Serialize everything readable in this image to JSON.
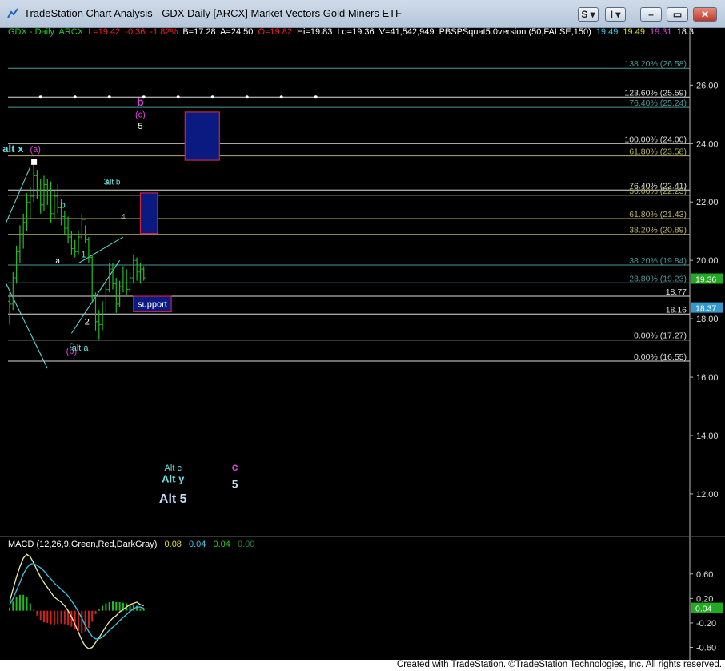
{
  "window": {
    "title": "TradeStation Chart Analysis - GDX Daily [ARCX] Market Vectors Gold Miners ETF",
    "buttons": [
      "S",
      "I"
    ]
  },
  "legend": {
    "symbol": "GDX - Daily",
    "exchange": "ARCX",
    "last": "L=19.42",
    "change": "-0.36",
    "change_pct": "-1.82%",
    "bid": "B=17.28",
    "ask": "A=24.50",
    "open": "O=19.82",
    "high": "Hi=19.83",
    "low": "Lo=19.36",
    "volume": "V=41,542,949",
    "study": "PBSPSquat5.0version (50,FALSE,150)",
    "study_v1": "19.49",
    "study_v2": "19.49",
    "study_v3": "19.31",
    "study_v4": "18.3"
  },
  "macd_legend": {
    "name": "MACD (12,26,9,Green,Red,DarkGray)",
    "v1": "0.08",
    "v2": "0.04",
    "v3": "0.04",
    "v4": "0.00"
  },
  "footer": "Created with TradeStation. ©TradeStation Technologies, Inc. All rights reserved.",
  "colors": {
    "background": "#000000",
    "grid_line": "#ffffff",
    "fib_line": "#b5b26a",
    "label_cyan": "#66e0e0",
    "label_magenta": "#dd44dd",
    "price_bar": "#22bb22",
    "box_fill": "#0a1a80",
    "box_border": "#cc2244",
    "macd_line": "#f0f0a0",
    "signal_line": "#3cc8e8"
  },
  "chart_data": [
    {
      "type": "bar",
      "title": "",
      "ylim": [
        10.6,
        27.6
      ],
      "y_ticks": [
        "26.00",
        "24.00",
        "22.00",
        "20.00",
        "18.00",
        "16.00",
        "14.00",
        "12.00"
      ],
      "price_markers": [
        {
          "label": "19.36",
          "value": 19.36
        },
        {
          "label": "18.37",
          "value": 18.37
        }
      ],
      "fib_levels": [
        {
          "label": "138.20% (26.58)",
          "value": 26.58,
          "color": "#4a9a9a"
        },
        {
          "label": "123.60% (25.59)",
          "value": 25.59,
          "color": "#dddddd"
        },
        {
          "label": "76.40% (25.24)",
          "value": 25.24,
          "color": "#4a9a9a"
        },
        {
          "label": "100.00% (24.00)",
          "value": 24.0,
          "color": "#dddddd"
        },
        {
          "label": "61.80% (23.58)",
          "value": 23.58,
          "color": "#b5b26a"
        },
        {
          "label": "76.40% (22.41)",
          "value": 22.41,
          "color": "#dddddd"
        },
        {
          "label": "50.00% (22.23)",
          "value": 22.23,
          "color": "#b5b26a"
        },
        {
          "label": "61.80% (21.43)",
          "value": 21.43,
          "color": "#b5b26a"
        },
        {
          "label": "38.20% (20.89)",
          "value": 20.89,
          "color": "#b5b26a"
        },
        {
          "label": "38.20% (19.84)",
          "value": 19.84,
          "color": "#4a9a9a"
        },
        {
          "label": "23.80% (19.23)",
          "value": 19.23,
          "color": "#4a9a9a"
        },
        {
          "label": "18.77",
          "value": 18.77,
          "color": "#dddddd"
        },
        {
          "label": "18.16",
          "value": 18.16,
          "color": "#dddddd"
        },
        {
          "label": "0.00% (17.27)",
          "value": 17.27,
          "color": "#dddddd"
        },
        {
          "label": "0.00% (16.55)",
          "value": 16.55,
          "color": "#dddddd"
        }
      ],
      "boxes": [
        {
          "name": "target-c-box",
          "top": 25.08,
          "bottom": 23.43,
          "x0": 51,
          "x1": 61
        },
        {
          "name": "alt-b-box",
          "top": 22.31,
          "bottom": 20.92,
          "x0": 38,
          "x1": 43
        },
        {
          "name": "support-box",
          "top": 18.77,
          "bottom": 18.24,
          "x0": 36,
          "x1": 47,
          "label": "support"
        }
      ],
      "bars": [
        {
          "o": 18.6,
          "h": 18.9,
          "l": 17.8,
          "c": 18.5
        },
        {
          "o": 18.5,
          "h": 19.6,
          "l": 18.3,
          "c": 19.4
        },
        {
          "o": 19.4,
          "h": 20.5,
          "l": 19.2,
          "c": 20.3
        },
        {
          "o": 20.3,
          "h": 21.2,
          "l": 19.9,
          "c": 20.9
        },
        {
          "o": 20.9,
          "h": 21.6,
          "l": 20.4,
          "c": 21.3
        },
        {
          "o": 21.3,
          "h": 22.3,
          "l": 21.0,
          "c": 22.0
        },
        {
          "o": 22.0,
          "h": 22.5,
          "l": 21.4,
          "c": 22.2
        },
        {
          "o": 22.2,
          "h": 23.3,
          "l": 22.0,
          "c": 22.9
        },
        {
          "o": 22.9,
          "h": 23.1,
          "l": 22.1,
          "c": 22.4
        },
        {
          "o": 22.4,
          "h": 22.8,
          "l": 21.6,
          "c": 21.9
        },
        {
          "o": 21.9,
          "h": 22.9,
          "l": 21.7,
          "c": 22.6
        },
        {
          "o": 22.6,
          "h": 22.8,
          "l": 21.9,
          "c": 22.1
        },
        {
          "o": 22.1,
          "h": 22.7,
          "l": 21.3,
          "c": 21.6
        },
        {
          "o": 21.6,
          "h": 22.4,
          "l": 21.4,
          "c": 22.2
        },
        {
          "o": 22.2,
          "h": 22.6,
          "l": 21.6,
          "c": 21.8
        },
        {
          "o": 21.8,
          "h": 22.1,
          "l": 21.2,
          "c": 21.5
        },
        {
          "o": 21.5,
          "h": 21.7,
          "l": 20.9,
          "c": 21.1
        },
        {
          "o": 21.1,
          "h": 21.5,
          "l": 20.6,
          "c": 20.8
        },
        {
          "o": 20.8,
          "h": 21.0,
          "l": 20.2,
          "c": 20.4
        },
        {
          "o": 20.4,
          "h": 20.7,
          "l": 20.1,
          "c": 20.3
        },
        {
          "o": 20.3,
          "h": 21.0,
          "l": 20.2,
          "c": 20.8
        },
        {
          "o": 20.8,
          "h": 21.6,
          "l": 20.7,
          "c": 21.4
        },
        {
          "o": 21.4,
          "h": 21.2,
          "l": 20.6,
          "c": 20.7
        },
        {
          "o": 20.7,
          "h": 20.8,
          "l": 19.9,
          "c": 20.1
        },
        {
          "o": 20.1,
          "h": 20.2,
          "l": 18.6,
          "c": 18.8
        },
        {
          "o": 18.8,
          "h": 18.9,
          "l": 17.6,
          "c": 17.9
        },
        {
          "o": 17.9,
          "h": 18.3,
          "l": 17.3,
          "c": 17.8
        },
        {
          "o": 17.8,
          "h": 18.6,
          "l": 17.6,
          "c": 18.4
        },
        {
          "o": 18.4,
          "h": 19.2,
          "l": 18.2,
          "c": 19.0
        },
        {
          "o": 19.0,
          "h": 19.9,
          "l": 18.9,
          "c": 19.7
        },
        {
          "o": 19.7,
          "h": 19.9,
          "l": 19.0,
          "c": 19.2
        },
        {
          "o": 19.2,
          "h": 19.4,
          "l": 18.2,
          "c": 18.5
        },
        {
          "o": 18.5,
          "h": 19.3,
          "l": 18.4,
          "c": 19.1
        },
        {
          "o": 19.1,
          "h": 19.8,
          "l": 18.9,
          "c": 19.5
        },
        {
          "o": 19.5,
          "h": 19.7,
          "l": 18.8,
          "c": 19.0
        },
        {
          "o": 19.0,
          "h": 19.6,
          "l": 18.9,
          "c": 19.4
        },
        {
          "o": 19.4,
          "h": 20.2,
          "l": 19.2,
          "c": 20.0
        },
        {
          "o": 20.0,
          "h": 20.1,
          "l": 19.3,
          "c": 19.6
        },
        {
          "o": 19.6,
          "h": 19.9,
          "l": 19.2,
          "c": 19.7
        },
        {
          "o": 19.7,
          "h": 19.8,
          "l": 19.3,
          "c": 19.4
        }
      ],
      "trendlines": [
        {
          "x0": 20,
          "y0": 19.9,
          "x1": 33,
          "y1": 20.8,
          "color": "#66e0e0"
        },
        {
          "x0": 18,
          "y0": 17.5,
          "x1": 32,
          "y1": 20.0,
          "color": "#66e0e0"
        },
        {
          "x0": -1,
          "y0": 19.2,
          "x1": 11,
          "y1": 16.3,
          "color": "#66e0e0"
        },
        {
          "x0": -1,
          "y0": 21.3,
          "x1": 6,
          "y1": 23.2,
          "color": "#66e0e0"
        }
      ],
      "annotations": [
        {
          "text": "alt x",
          "x": 1,
          "y": 23.7,
          "color": "#66e0e0",
          "size": 13,
          "bold": true
        },
        {
          "text": "(a)",
          "x": 7.5,
          "y": 23.7,
          "color": "#dd44dd",
          "size": 11
        },
        {
          "text": "b",
          "x": 15.5,
          "y": 21.8,
          "color": "#66e0e0",
          "size": 11
        },
        {
          "text": "a",
          "x": 14,
          "y": 19.9,
          "color": "#ffffff",
          "size": 10
        },
        {
          "text": "1",
          "x": 21.5,
          "y": 20.1,
          "color": "#66e0e0",
          "size": 11
        },
        {
          "text": "2",
          "x": 22.5,
          "y": 17.8,
          "color": "#ffffff",
          "size": 11
        },
        {
          "text": "c",
          "x": 18,
          "y": 17.0,
          "color": "#66e0e0",
          "size": 11
        },
        {
          "text": "(b)",
          "x": 18,
          "y": 16.8,
          "color": "#dd44dd",
          "size": 11
        },
        {
          "text": "alt a",
          "x": 20.5,
          "y": 16.9,
          "color": "#66e0e0",
          "size": 11
        },
        {
          "text": "3",
          "x": 28,
          "y": 22.6,
          "color": "#66e0e0",
          "size": 11
        },
        {
          "text": "alt b",
          "x": 30,
          "y": 22.6,
          "color": "#66e0e0",
          "size": 10
        },
        {
          "text": "4",
          "x": 33,
          "y": 21.4,
          "color": "#aaaaaa",
          "size": 10
        },
        {
          "text": "b",
          "x": 38,
          "y": 25.3,
          "color": "#dd44dd",
          "size": 14,
          "bold": true
        },
        {
          "text": "(c)",
          "x": 38,
          "y": 24.9,
          "color": "#dd44dd",
          "size": 11
        },
        {
          "text": "5",
          "x": 38,
          "y": 24.5,
          "color": "#ffffff",
          "size": 11
        },
        {
          "text": "Alt c",
          "x": 47.5,
          "y": 12.8,
          "color": "#66e0e0",
          "size": 11
        },
        {
          "text": "Alt y",
          "x": 47.5,
          "y": 12.4,
          "color": "#66e0e0",
          "size": 13,
          "bold": true
        },
        {
          "text": "Alt 5",
          "x": 47.5,
          "y": 11.7,
          "color": "#c8d8f8",
          "size": 16,
          "bold": true
        },
        {
          "text": "c",
          "x": 65.5,
          "y": 12.8,
          "color": "#dd44dd",
          "size": 14,
          "bold": true
        },
        {
          "text": "5",
          "x": 65.5,
          "y": 12.2,
          "color": "#c8d8f8",
          "size": 14,
          "bold": true
        }
      ],
      "dotted_line": {
        "value": 25.59,
        "dots_x": [
          9,
          19,
          29,
          39,
          49,
          59,
          69,
          79,
          89
        ]
      }
    },
    {
      "type": "line",
      "title": "MACD (12,26,9,Green,Red,DarkGray)",
      "ylim": [
        -0.75,
        0.95
      ],
      "y_ticks": [
        "0.60",
        "0.20",
        "-0.20",
        "-0.60"
      ],
      "price_markers": [
        {
          "label": "0.04",
          "value": 0.04
        }
      ],
      "series": [
        {
          "values": [
            0.15,
            0.35,
            0.55,
            0.72,
            0.86,
            0.92,
            0.88,
            0.78,
            0.66,
            0.55,
            0.46,
            0.38,
            0.3,
            0.22,
            0.18,
            0.14,
            0.08,
            0.0,
            -0.1,
            -0.22,
            -0.35,
            -0.48,
            -0.58,
            -0.62,
            -0.6,
            -0.52,
            -0.44,
            -0.35,
            -0.26,
            -0.18,
            -0.12,
            -0.08,
            -0.02,
            0.02,
            0.06,
            0.1,
            0.12,
            0.14,
            0.1,
            0.08
          ],
          "color": "#f0f0a0"
        },
        {
          "values": [
            0.1,
            0.2,
            0.33,
            0.46,
            0.6,
            0.7,
            0.76,
            0.77,
            0.74,
            0.7,
            0.65,
            0.58,
            0.52,
            0.45,
            0.4,
            0.35,
            0.3,
            0.24,
            0.16,
            0.08,
            -0.02,
            -0.12,
            -0.24,
            -0.34,
            -0.42,
            -0.46,
            -0.46,
            -0.43,
            -0.38,
            -0.32,
            -0.27,
            -0.22,
            -0.16,
            -0.11,
            -0.06,
            -0.01,
            0.03,
            0.06,
            0.06,
            0.04
          ],
          "color": "#3cc8e8"
        }
      ],
      "histogram": [
        0.05,
        0.15,
        0.22,
        0.26,
        0.26,
        0.22,
        0.12,
        0.01,
        -0.08,
        -0.15,
        -0.19,
        -0.2,
        -0.22,
        -0.23,
        -0.22,
        -0.21,
        -0.22,
        -0.24,
        -0.26,
        -0.3,
        -0.33,
        -0.36,
        -0.34,
        -0.28,
        -0.18,
        -0.06,
        0.02,
        0.08,
        0.12,
        0.14,
        0.15,
        0.14,
        0.14,
        0.13,
        0.12,
        0.11,
        0.09,
        0.08,
        0.04,
        0.04
      ]
    }
  ]
}
